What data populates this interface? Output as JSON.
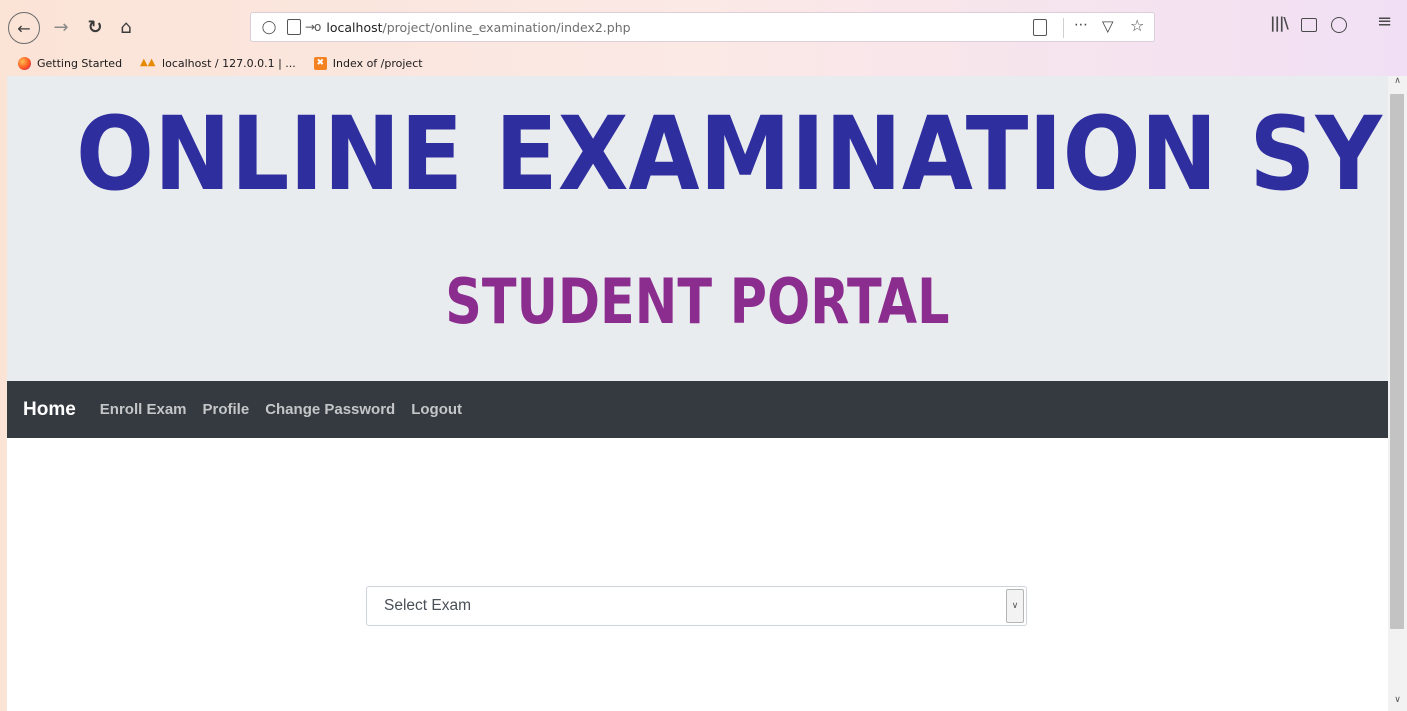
{
  "browser": {
    "url_host": "localhost",
    "url_path": "/project/online_examination/index2.php",
    "bookmarks": [
      {
        "label": "Getting Started",
        "icon": "firefox-icon"
      },
      {
        "label": "localhost / 127.0.0.1 | ...",
        "icon": "phpmyadmin-icon"
      },
      {
        "label": "Index of /project",
        "icon": "xampp-icon"
      }
    ]
  },
  "banner": {
    "title": "ONLINE EXAMINATION SYSTEM",
    "subtitle": "STUDENT PORTAL",
    "title_color": "#2e2e9e",
    "subtitle_color": "#8b2d8e"
  },
  "navbar": {
    "brand": "Home",
    "links": [
      "Enroll Exam",
      "Profile",
      "Change Password",
      "Logout"
    ]
  },
  "exam_select": {
    "selected": "Select Exam"
  }
}
